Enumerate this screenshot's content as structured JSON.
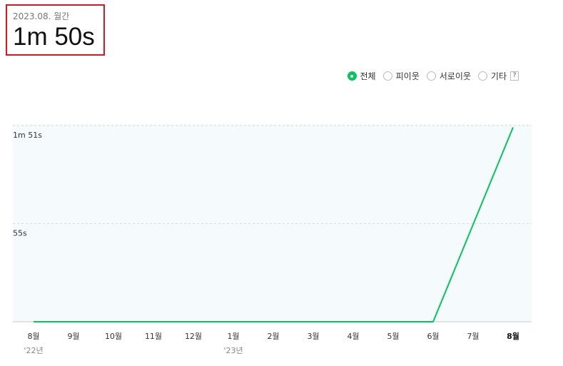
{
  "summary": {
    "period_label": "2023.08. 월간",
    "value": "1m 50s"
  },
  "filters": {
    "options": [
      {
        "label": "전체",
        "checked": true
      },
      {
        "label": "피이웃",
        "checked": false
      },
      {
        "label": "서로이웃",
        "checked": false
      },
      {
        "label": "기타",
        "checked": false
      }
    ],
    "help_label": "?"
  },
  "chart_data": {
    "type": "line",
    "categories": [
      "8월",
      "9월",
      "10월",
      "11월",
      "12월",
      "1월",
      "2월",
      "3월",
      "4월",
      "5월",
      "6월",
      "7월",
      "8월"
    ],
    "year_labels": [
      {
        "index": 0,
        "label": "'22년"
      },
      {
        "index": 5,
        "label": "'23년"
      }
    ],
    "highlight_index": 12,
    "series": [
      {
        "values_seconds": [
          0,
          0,
          0,
          0,
          0,
          0,
          0,
          0,
          0,
          0,
          0,
          55,
          110
        ],
        "color": "#03c75a"
      }
    ],
    "y_tick_labels": [
      "1m 51s",
      "55s"
    ],
    "y_tick_values": [
      111,
      55.5
    ],
    "ylim": [
      0,
      111
    ],
    "grid": true,
    "plot_background": "#f5fbfd"
  }
}
